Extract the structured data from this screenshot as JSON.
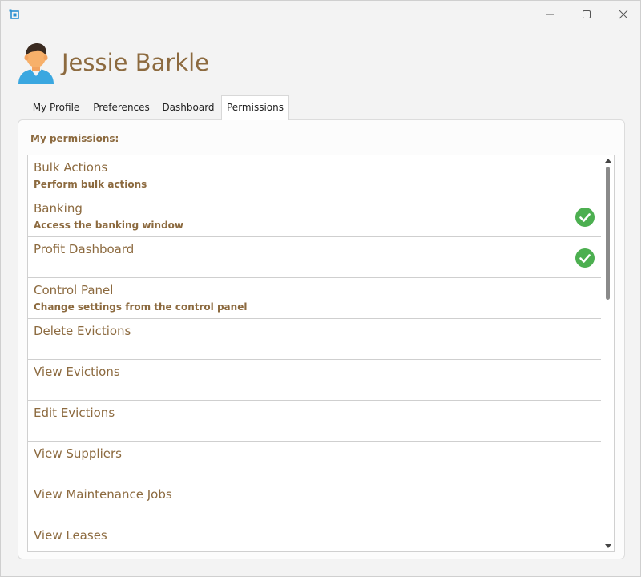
{
  "window": {
    "icons": {
      "app": "app-icon",
      "minimize": "minimize-icon",
      "maximize": "maximize-icon",
      "close": "close-icon"
    }
  },
  "user": {
    "name": "Jessie Barkle",
    "avatar_icon": "person-avatar-icon"
  },
  "tabs": [
    {
      "label": "My Profile",
      "active": false
    },
    {
      "label": "Preferences",
      "active": false
    },
    {
      "label": "Dashboard",
      "active": false
    },
    {
      "label": "Permissions",
      "active": true
    }
  ],
  "permissions": {
    "section_label": "My permissions:",
    "items": [
      {
        "title": "Bulk Actions",
        "description": "Perform bulk actions",
        "granted": false
      },
      {
        "title": "Banking",
        "description": "Access the banking window",
        "granted": true
      },
      {
        "title": "Profit Dashboard",
        "description": "",
        "granted": true
      },
      {
        "title": "Control Panel",
        "description": "Change settings from the control panel",
        "granted": false
      },
      {
        "title": "Delete Evictions",
        "description": "",
        "granted": false
      },
      {
        "title": "View Evictions",
        "description": "",
        "granted": false
      },
      {
        "title": "Edit Evictions",
        "description": "",
        "granted": false
      },
      {
        "title": "View Suppliers",
        "description": "",
        "granted": false
      },
      {
        "title": "View Maintenance Jobs",
        "description": "",
        "granted": false
      },
      {
        "title": "View Leases",
        "description": "",
        "granted": false
      }
    ],
    "granted_icon": "green-check-circle-icon",
    "scroll_position": 0
  },
  "colors": {
    "accent_text": "#8c6a3f",
    "granted": "#4caf50"
  }
}
